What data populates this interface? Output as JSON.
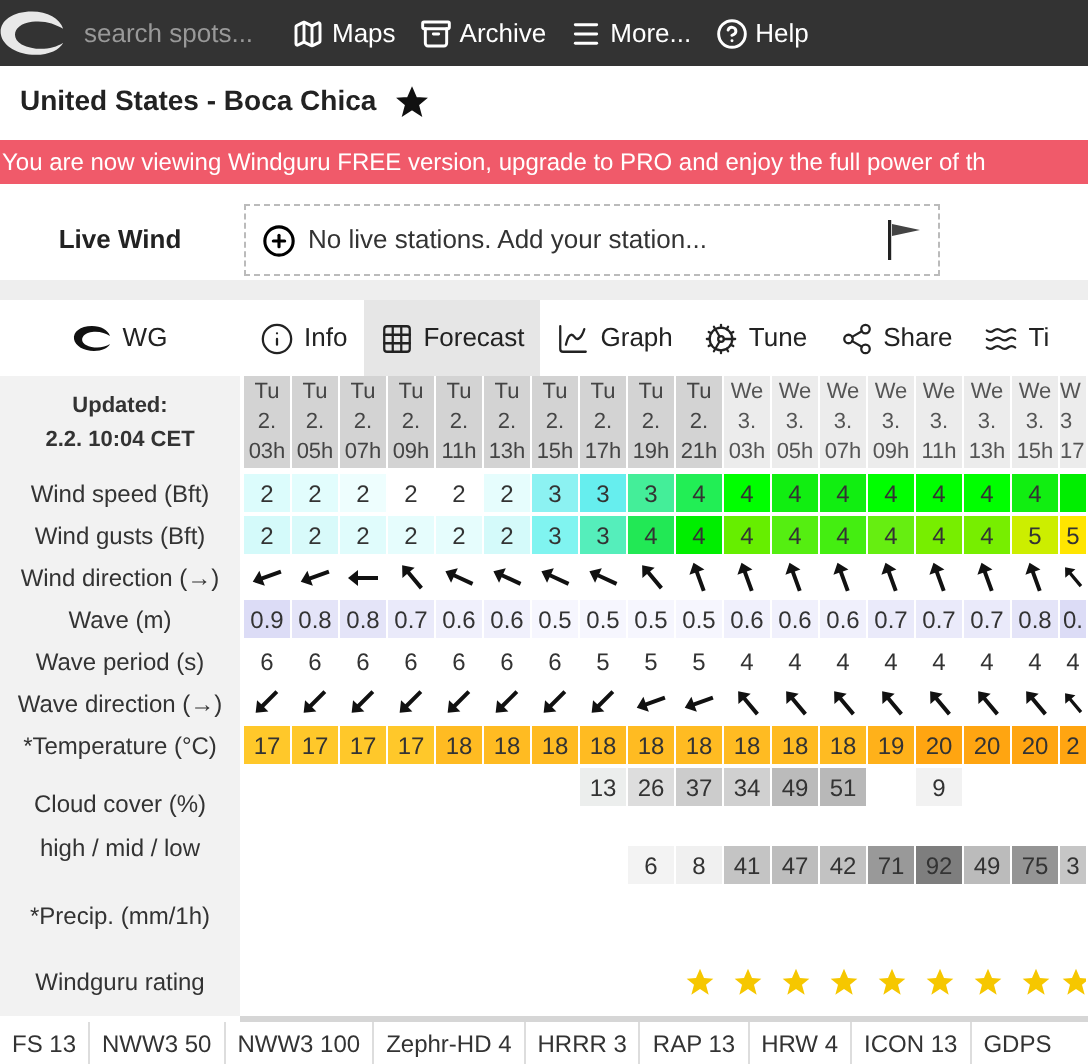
{
  "nav": {
    "search": {
      "placeholder": "search spots..."
    },
    "items": [
      {
        "label": "Maps",
        "kind": "maps"
      },
      {
        "label": "Archive",
        "kind": "archive"
      },
      {
        "label": "More...",
        "kind": "more"
      },
      {
        "label": "Help",
        "kind": "help"
      }
    ]
  },
  "spot": {
    "title": "United States - Boca Chica",
    "favorite": true
  },
  "banner": "You are now viewing Windguru FREE version, upgrade to PRO and enjoy the full power of th",
  "live_wind": {
    "label": "Live Wind",
    "message": "No live stations. Add your station..."
  },
  "tabs": [
    {
      "label": "WG",
      "kind": "logo",
      "selected": false
    },
    {
      "label": "Info",
      "kind": "info",
      "selected": false
    },
    {
      "label": "Forecast",
      "kind": "forecast",
      "selected": true
    },
    {
      "label": "Graph",
      "kind": "graph",
      "selected": false
    },
    {
      "label": "Tune",
      "kind": "tune",
      "selected": false
    },
    {
      "label": "Share",
      "kind": "share",
      "selected": false
    },
    {
      "label": "Ti",
      "kind": "tides",
      "selected": false
    }
  ],
  "forecast": {
    "updated_label": "Updated:",
    "updated": "2.2. 10:04 CET",
    "columns": [
      {
        "day": "Tu",
        "date": "2.",
        "hour": "03h",
        "kind": "shaded"
      },
      {
        "day": "Tu",
        "date": "2.",
        "hour": "05h",
        "kind": "shaded"
      },
      {
        "day": "Tu",
        "date": "2.",
        "hour": "07h",
        "kind": "shaded"
      },
      {
        "day": "Tu",
        "date": "2.",
        "hour": "09h",
        "kind": "shaded"
      },
      {
        "day": "Tu",
        "date": "2.",
        "hour": "11h",
        "kind": "shaded"
      },
      {
        "day": "Tu",
        "date": "2.",
        "hour": "13h",
        "kind": "shaded"
      },
      {
        "day": "Tu",
        "date": "2.",
        "hour": "15h",
        "kind": "shaded"
      },
      {
        "day": "Tu",
        "date": "2.",
        "hour": "17h",
        "kind": "shaded"
      },
      {
        "day": "Tu",
        "date": "2.",
        "hour": "19h",
        "kind": "shaded"
      },
      {
        "day": "Tu",
        "date": "2.",
        "hour": "21h",
        "kind": "shaded"
      },
      {
        "day": "We",
        "date": "3.",
        "hour": "03h",
        "kind": "plain"
      },
      {
        "day": "We",
        "date": "3.",
        "hour": "05h",
        "kind": "plain"
      },
      {
        "day": "We",
        "date": "3.",
        "hour": "07h",
        "kind": "plain"
      },
      {
        "day": "We",
        "date": "3.",
        "hour": "09h",
        "kind": "plain"
      },
      {
        "day": "We",
        "date": "3.",
        "hour": "11h",
        "kind": "plain"
      },
      {
        "day": "We",
        "date": "3.",
        "hour": "13h",
        "kind": "plain"
      },
      {
        "day": "We",
        "date": "3.",
        "hour": "15h",
        "kind": "plain"
      },
      {
        "day": "W",
        "date": "3",
        "hour": "17",
        "kind": "plain"
      }
    ],
    "rows": [
      {
        "label": "Wind speed (Bft)",
        "kind": "values",
        "cells": [
          {
            "text": "2",
            "color": "#dcfcfc"
          },
          {
            "text": "2",
            "color": "#e2fdfd"
          },
          {
            "text": "2",
            "color": "#eefefe"
          },
          {
            "text": "2",
            "color": "#ffffff"
          },
          {
            "text": "2",
            "color": "#ffffff"
          },
          {
            "text": "2",
            "color": "#e6fdfd"
          },
          {
            "text": "3",
            "color": "#8cf2f2"
          },
          {
            "text": "3",
            "color": "#66eeee"
          },
          {
            "text": "3",
            "color": "#44ee99"
          },
          {
            "text": "4",
            "color": "#22ee55"
          },
          {
            "text": "4",
            "color": "#00ff00"
          },
          {
            "text": "4",
            "color": "#11ee11"
          },
          {
            "text": "4",
            "color": "#11ee11"
          },
          {
            "text": "4",
            "color": "#00ff00"
          },
          {
            "text": "4",
            "color": "#00ff00"
          },
          {
            "text": "4",
            "color": "#00ff00"
          },
          {
            "text": "4",
            "color": "#11ee11"
          },
          {
            "color": "#00ee00"
          }
        ]
      },
      {
        "label": "Wind gusts (Bft)",
        "kind": "values",
        "cells": [
          {
            "text": "2",
            "color": "#d4fafa"
          },
          {
            "text": "2",
            "color": "#d8fafa"
          },
          {
            "text": "2",
            "color": "#e0fcfc"
          },
          {
            "text": "2",
            "color": "#e6fdfd"
          },
          {
            "text": "2",
            "color": "#e6fdfd"
          },
          {
            "text": "2",
            "color": "#d4fafa"
          },
          {
            "text": "3",
            "color": "#80f4f0"
          },
          {
            "text": "3",
            "color": "#55eebb"
          },
          {
            "text": "4",
            "color": "#22e855"
          },
          {
            "text": "4",
            "color": "#00ee00"
          },
          {
            "text": "4",
            "color": "#66ee00"
          },
          {
            "text": "4",
            "color": "#55ee11"
          },
          {
            "text": "4",
            "color": "#44ee11"
          },
          {
            "text": "4",
            "color": "#66ee11"
          },
          {
            "text": "4",
            "color": "#77ee00"
          },
          {
            "text": "4",
            "color": "#77ee00"
          },
          {
            "text": "5",
            "color": "#ccee00"
          },
          {
            "text": "5",
            "color": "#ffe500"
          }
        ]
      },
      {
        "label": "Wind direction (→)",
        "kind": "arrows",
        "directions": [
          {
            "kind": "wsw"
          },
          {
            "kind": "wsw"
          },
          {
            "kind": "w"
          },
          {
            "kind": "nw"
          },
          {
            "kind": "wnw"
          },
          {
            "kind": "wnw"
          },
          {
            "kind": "wnw"
          },
          {
            "kind": "wnw"
          },
          {
            "kind": "nw"
          },
          {
            "kind": "nnw"
          },
          {
            "kind": "nnw"
          },
          {
            "kind": "nnw"
          },
          {
            "kind": "nnw"
          },
          {
            "kind": "nnw"
          },
          {
            "kind": "nnw"
          },
          {
            "kind": "nnw"
          },
          {
            "kind": "nnw"
          },
          {
            "kind": "nw"
          }
        ]
      },
      {
        "label": "Wave (m)",
        "kind": "values",
        "cells": [
          {
            "text": "0.9",
            "color": "#dcdcf6"
          },
          {
            "text": "0.8",
            "color": "#e4e4f8"
          },
          {
            "text": "0.8",
            "color": "#e4e4f8"
          },
          {
            "text": "0.7",
            "color": "#eaeafa"
          },
          {
            "text": "0.6",
            "color": "#f0f0fc"
          },
          {
            "text": "0.6",
            "color": "#f0f0fc"
          },
          {
            "text": "0.5",
            "color": "#f6f6fe"
          },
          {
            "text": "0.5",
            "color": "#f6f6fe"
          },
          {
            "text": "0.5",
            "color": "#f6f6fe"
          },
          {
            "text": "0.5",
            "color": "#f6f6fe"
          },
          {
            "text": "0.6",
            "color": "#f0f0fc"
          },
          {
            "text": "0.6",
            "color": "#f0f0fc"
          },
          {
            "text": "0.6",
            "color": "#f0f0fc"
          },
          {
            "text": "0.7",
            "color": "#eaeafa"
          },
          {
            "text": "0.7",
            "color": "#eaeafa"
          },
          {
            "text": "0.7",
            "color": "#eaeafa"
          },
          {
            "text": "0.8",
            "color": "#e4e4f8"
          },
          {
            "text": "0.",
            "color": "#dcdcf6"
          }
        ]
      },
      {
        "label": "Wave period (s)",
        "kind": "plain",
        "texts": [
          "6",
          "6",
          "6",
          "6",
          "6",
          "6",
          "6",
          "5",
          "5",
          "5",
          "4",
          "4",
          "4",
          "4",
          "4",
          "4",
          "4",
          "4"
        ]
      },
      {
        "label": "Wave direction (→)",
        "kind": "arrows",
        "directions": [
          {
            "kind": "sw"
          },
          {
            "kind": "sw"
          },
          {
            "kind": "sw"
          },
          {
            "kind": "sw"
          },
          {
            "kind": "sw"
          },
          {
            "kind": "sw"
          },
          {
            "kind": "sw"
          },
          {
            "kind": "sw"
          },
          {
            "kind": "wsw"
          },
          {
            "kind": "wsw"
          },
          {
            "kind": "nw"
          },
          {
            "kind": "nw"
          },
          {
            "kind": "nw"
          },
          {
            "kind": "nw"
          },
          {
            "kind": "nw"
          },
          {
            "kind": "nw"
          },
          {
            "kind": "nw"
          },
          {
            "kind": "nw"
          }
        ]
      },
      {
        "label": "*Temperature (°C)",
        "kind": "values",
        "cells": [
          {
            "text": "17",
            "color": "#ffc82a"
          },
          {
            "text": "17",
            "color": "#ffc82a"
          },
          {
            "text": "17",
            "color": "#ffc82a"
          },
          {
            "text": "17",
            "color": "#ffc82a"
          },
          {
            "text": "18",
            "color": "#ffbb22"
          },
          {
            "text": "18",
            "color": "#ffbb22"
          },
          {
            "text": "18",
            "color": "#ffbb22"
          },
          {
            "text": "18",
            "color": "#ffbb22"
          },
          {
            "text": "18",
            "color": "#ffbb22"
          },
          {
            "text": "18",
            "color": "#ffbb22"
          },
          {
            "text": "18",
            "color": "#ffbb22"
          },
          {
            "text": "18",
            "color": "#ffbb22"
          },
          {
            "text": "18",
            "color": "#ffbb22"
          },
          {
            "text": "19",
            "color": "#ffb11a"
          },
          {
            "text": "20",
            "color": "#ffa511"
          },
          {
            "text": "20",
            "color": "#ffa511"
          },
          {
            "text": "20",
            "color": "#ffa511"
          },
          {
            "text": "2",
            "color": "#ffa511"
          }
        ]
      }
    ],
    "clouds": {
      "label": "Cloud cover (%)",
      "sublabel": "high / mid / low",
      "high": [
        {
          "kind": "empty"
        },
        {
          "kind": "empty"
        },
        {
          "kind": "empty"
        },
        {
          "kind": "empty"
        },
        {
          "kind": "empty"
        },
        {
          "kind": "empty"
        },
        {
          "kind": "empty"
        },
        {
          "kind": "value",
          "text": "13",
          "color": "#eceeed"
        },
        {
          "kind": "value",
          "text": "26",
          "color": "#dddddd"
        },
        {
          "kind": "value",
          "text": "37",
          "color": "#cccccc"
        },
        {
          "kind": "value",
          "text": "34",
          "color": "#d0d0d0"
        },
        {
          "kind": "value",
          "text": "49",
          "color": "#bbbbbb"
        },
        {
          "kind": "value",
          "text": "51",
          "color": "#b8b8b8"
        },
        {
          "kind": "empty"
        },
        {
          "kind": "value",
          "text": "9",
          "color": "#f2f2f2"
        },
        {
          "kind": "empty"
        },
        {
          "kind": "empty"
        },
        {
          "kind": "empty"
        }
      ],
      "low": [
        {
          "kind": "empty"
        },
        {
          "kind": "empty"
        },
        {
          "kind": "empty"
        },
        {
          "kind": "empty"
        },
        {
          "kind": "empty"
        },
        {
          "kind": "empty"
        },
        {
          "kind": "empty"
        },
        {
          "kind": "empty"
        },
        {
          "kind": "value",
          "text": "6",
          "color": "#f3f3f3"
        },
        {
          "kind": "value",
          "text": "8",
          "color": "#f0f0f0"
        },
        {
          "kind": "value",
          "text": "41",
          "color": "#c4c4c4"
        },
        {
          "kind": "value",
          "text": "47",
          "color": "#bdbdbd"
        },
        {
          "kind": "value",
          "text": "42",
          "color": "#c2c2c2"
        },
        {
          "kind": "value",
          "text": "71",
          "color": "#999999"
        },
        {
          "kind": "value",
          "text": "92",
          "color": "#7e7e7e"
        },
        {
          "kind": "value",
          "text": "49",
          "color": "#bbbbbb"
        },
        {
          "kind": "value",
          "text": "75",
          "color": "#959595"
        },
        {
          "kind": "value",
          "text": "3",
          "color": "#c6c6c6"
        }
      ]
    },
    "precip": {
      "label": "*Precip. (mm/1h)"
    },
    "rating": {
      "label": "Windguru rating",
      "stars": 9
    }
  },
  "models": [
    "FS 13",
    "NWW3 50",
    "NWW3 100",
    "Zephr-HD 4",
    "HRRR 3",
    "RAP 13",
    "HRW 4",
    "ICON 13",
    "GDPS"
  ]
}
